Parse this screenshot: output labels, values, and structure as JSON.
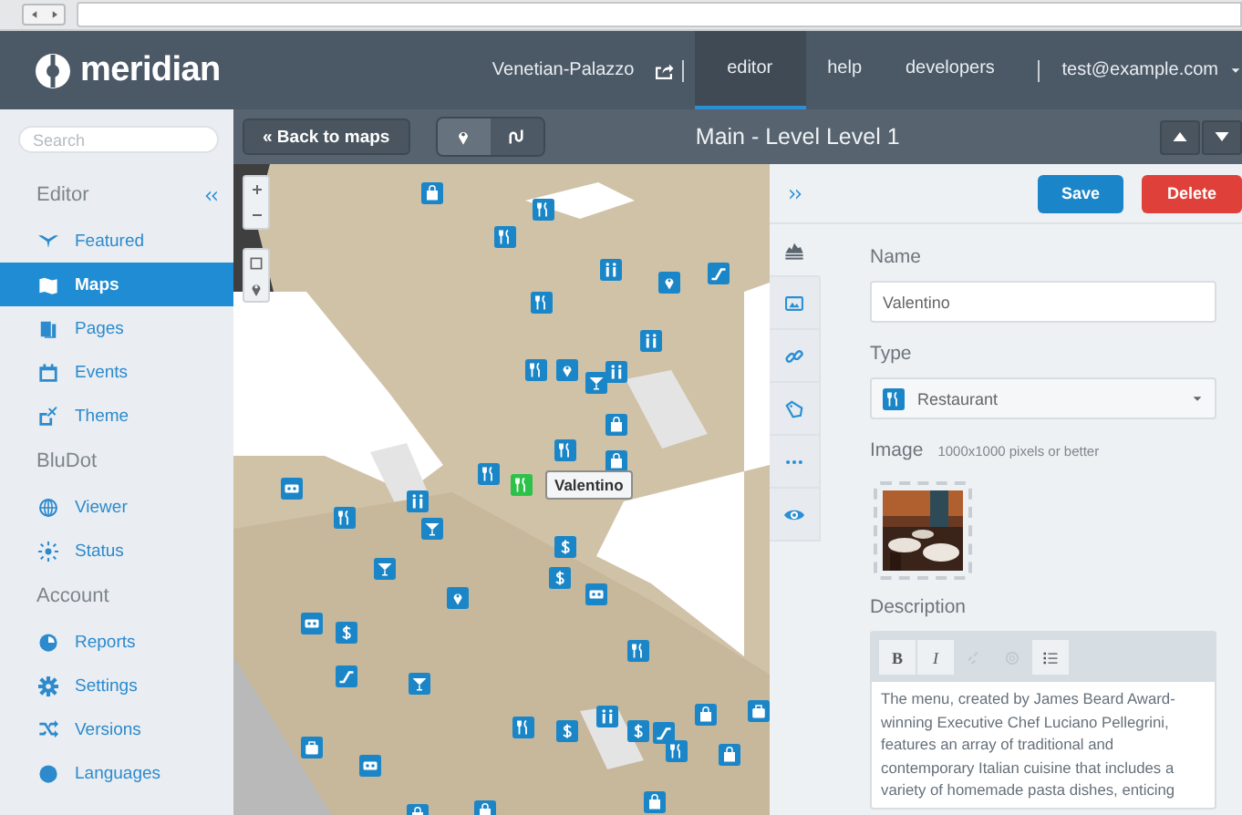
{
  "header": {
    "logo": "meridian",
    "location": "Venetian-Palazzo",
    "links": [
      {
        "label": "editor",
        "selected": true
      },
      {
        "label": "help",
        "selected": false
      },
      {
        "label": "developers",
        "selected": false
      }
    ],
    "user": "test@example.com"
  },
  "sidebar": {
    "search": {
      "placeholder": "Search"
    },
    "sections": [
      {
        "title": "Editor",
        "items": [
          {
            "label": "Featured",
            "selected": false
          },
          {
            "label": "Maps",
            "selected": true
          },
          {
            "label": "Pages",
            "selected": false
          },
          {
            "label": "Events",
            "selected": false
          },
          {
            "label": "Theme",
            "selected": false
          }
        ]
      },
      {
        "title": "BluDot",
        "items": [
          {
            "label": "Viewer",
            "selected": false
          },
          {
            "label": "Status",
            "selected": false
          }
        ]
      },
      {
        "title": "Account",
        "items": [
          {
            "label": "Reports",
            "selected": false
          },
          {
            "label": "Settings",
            "selected": false
          },
          {
            "label": "Versions",
            "selected": false
          },
          {
            "label": "Languages",
            "selected": false
          }
        ]
      }
    ]
  },
  "toolbar": {
    "back_button": "« Back to maps",
    "modes": [
      {
        "selected": true
      },
      {
        "selected": false
      }
    ],
    "title": "Main - Level Level 1"
  },
  "map": {
    "selected_marker": {
      "label": "Valentino"
    }
  },
  "panel": {
    "save": "Save",
    "delete": "Delete",
    "tabs": [
      {
        "selected": true
      },
      {
        "selected": false
      },
      {
        "selected": false
      },
      {
        "selected": false
      },
      {
        "selected": false
      },
      {
        "selected": false
      }
    ],
    "name": {
      "label": "Name",
      "value": "Valentino"
    },
    "type": {
      "label": "Type",
      "value": "Restaurant"
    },
    "image": {
      "label": "Image",
      "hint": "1000x1000 pixels or better",
      "kind": "picture"
    },
    "description": {
      "label": "Description",
      "buttons": [
        {
          "kind": "bold",
          "label": "B",
          "disabled": false
        },
        {
          "kind": "italic",
          "label": "I",
          "disabled": false
        },
        {
          "kind": "link",
          "disabled": true
        },
        {
          "kind": "unlink",
          "disabled": true
        },
        {
          "kind": "list",
          "disabled": false
        }
      ],
      "text": "The menu, created by James Beard Award-winning Executive Chef Luciano Pellegrini, features an array of traditional and contemporary Italian cuisine that includes a variety of homemade pasta dishes, enticing"
    }
  }
}
